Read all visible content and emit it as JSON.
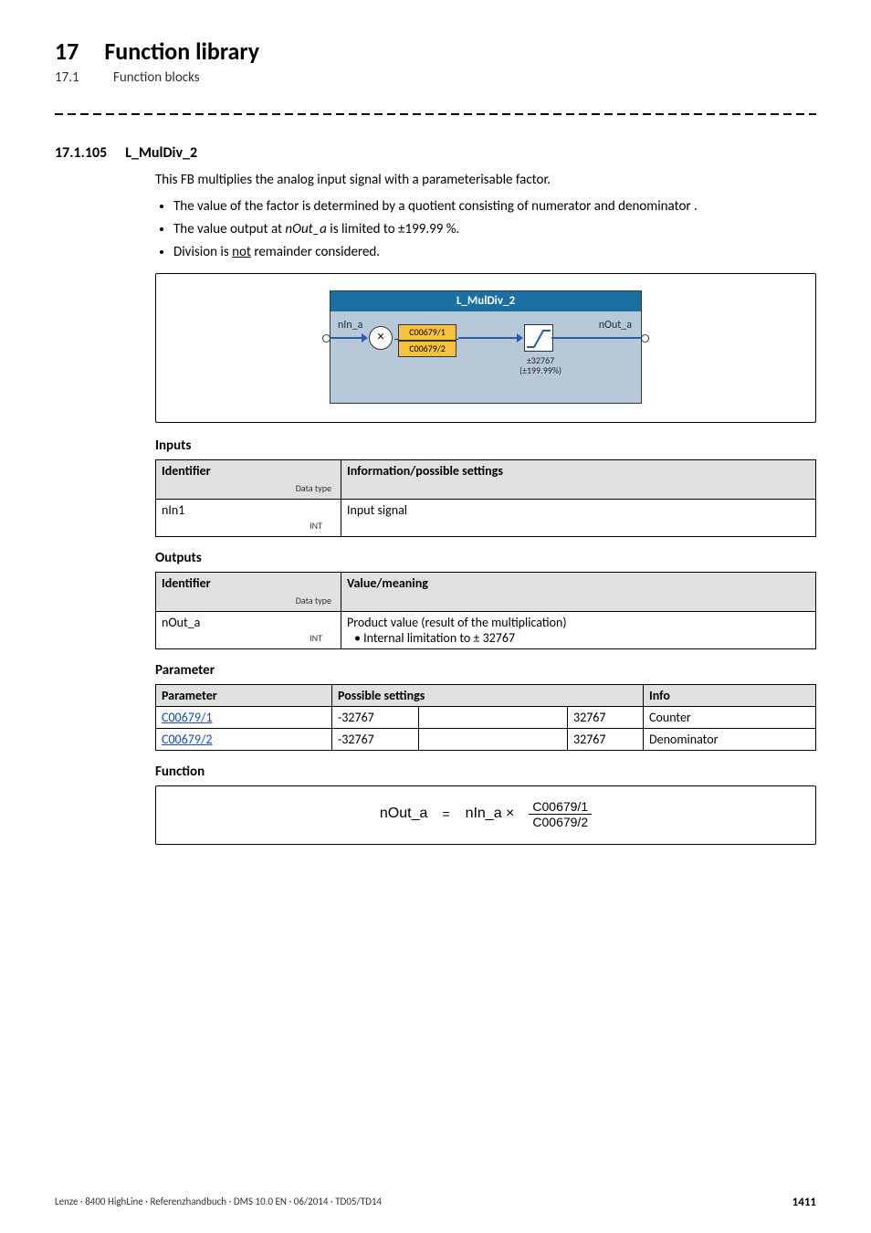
{
  "header": {
    "chapter_number": "17",
    "chapter_title": "Function library",
    "sub_number": "17.1",
    "sub_title": "Function blocks"
  },
  "section": {
    "number": "17.1.105",
    "title": "L_MulDiv_2"
  },
  "intro": {
    "para": "This FB multiplies the analog input signal with a parameterisable factor.",
    "bullets": [
      "The value of the factor is determined by a quotient consisting of numerator  and denominator .",
      "The value output at nOut_a is limited to ±199.99 %.",
      "Division is not remainder considered."
    ],
    "b2_prefix": "The value output at ",
    "b2_ital": "nOut_a",
    "b2_suffix": " is limited to ±199.99 %.",
    "b3_prefix": "Division is ",
    "b3_und": "not",
    "b3_suffix": " remainder considered."
  },
  "diagram": {
    "title": "L_MulDiv_2",
    "in_port": "nIn_a",
    "out_port": "nOut_a",
    "mul_sym": "×",
    "param_top": "C00679/1",
    "param_bot": "C00679/2",
    "limit_line1": "±32767",
    "limit_line2": "(±199.99%)"
  },
  "inputs": {
    "heading": "Inputs",
    "col1_top": "Identifier",
    "col1_sub": "Data type",
    "col2": "Information/possible settings",
    "rows": [
      {
        "name": "nIn1",
        "dtype": "INT",
        "info": "Input signal"
      }
    ]
  },
  "outputs": {
    "heading": "Outputs",
    "col1_top": "Identifier",
    "col1_sub": "Data type",
    "col2": "Value/meaning",
    "rows": [
      {
        "name": "nOut_a",
        "dtype": "INT",
        "info_l1": "Product value (result of the multiplication)",
        "info_l2": "• Internal limitation to ± 32767"
      }
    ]
  },
  "params": {
    "heading": "Parameter",
    "col_param": "Parameter",
    "col_poss": "Possible settings",
    "col_info": "Info",
    "rows": [
      {
        "link": "C00679/1",
        "min": "-32767",
        "mid": "",
        "max": "32767",
        "info": "Counter"
      },
      {
        "link": "C00679/2",
        "min": "-32767",
        "mid": "",
        "max": "32767",
        "info": "Denominator"
      }
    ]
  },
  "function": {
    "heading": "Function",
    "lhs": "nOut_a",
    "eq": "=",
    "rhs_pre": "nIn_a ×",
    "num": "C00679/1",
    "den": "C00679/2"
  },
  "footer": {
    "left": "Lenze · 8400 HighLine · Referenzhandbuch · DMS 10.0 EN · 06/2014 · TD05/TD14",
    "page": "1411"
  }
}
